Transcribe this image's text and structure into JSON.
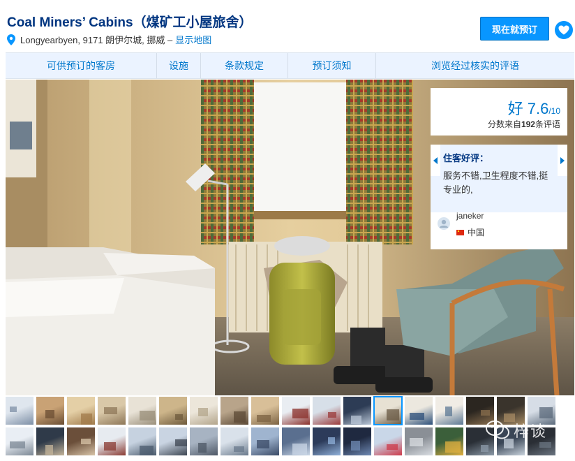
{
  "header": {
    "title": "Coal Miners’ Cabins（煤矿工小屋旅舍）",
    "address": "Longyearbyen, 9171 朗伊尔城, 挪威 –",
    "map_link": "显示地图",
    "book_button": "现在就预订"
  },
  "tabs": [
    {
      "label": "可供预订的客房"
    },
    {
      "label": "设施"
    },
    {
      "label": "条款规定"
    },
    {
      "label": "预订须知"
    },
    {
      "label": "浏览经过核实的评语"
    }
  ],
  "score": {
    "word": "好",
    "value": "7.6",
    "denominator": "/10",
    "sub_prefix": "分数来自",
    "count": "192",
    "sub_suffix": "条评语"
  },
  "review": {
    "heading": "住客好评：",
    "text": "服务不错,卫生程度不错,挺专业的,",
    "reviewer": "janeker",
    "country": "中国"
  },
  "gallery": {
    "thumbnail_count": 36,
    "selected_index": 12
  },
  "watermark": {
    "text": "梓谈"
  },
  "colors": {
    "brand_dark": "#003580",
    "link": "#0077cc",
    "button": "#0896ff",
    "tab_bg": "#ebf3ff"
  }
}
